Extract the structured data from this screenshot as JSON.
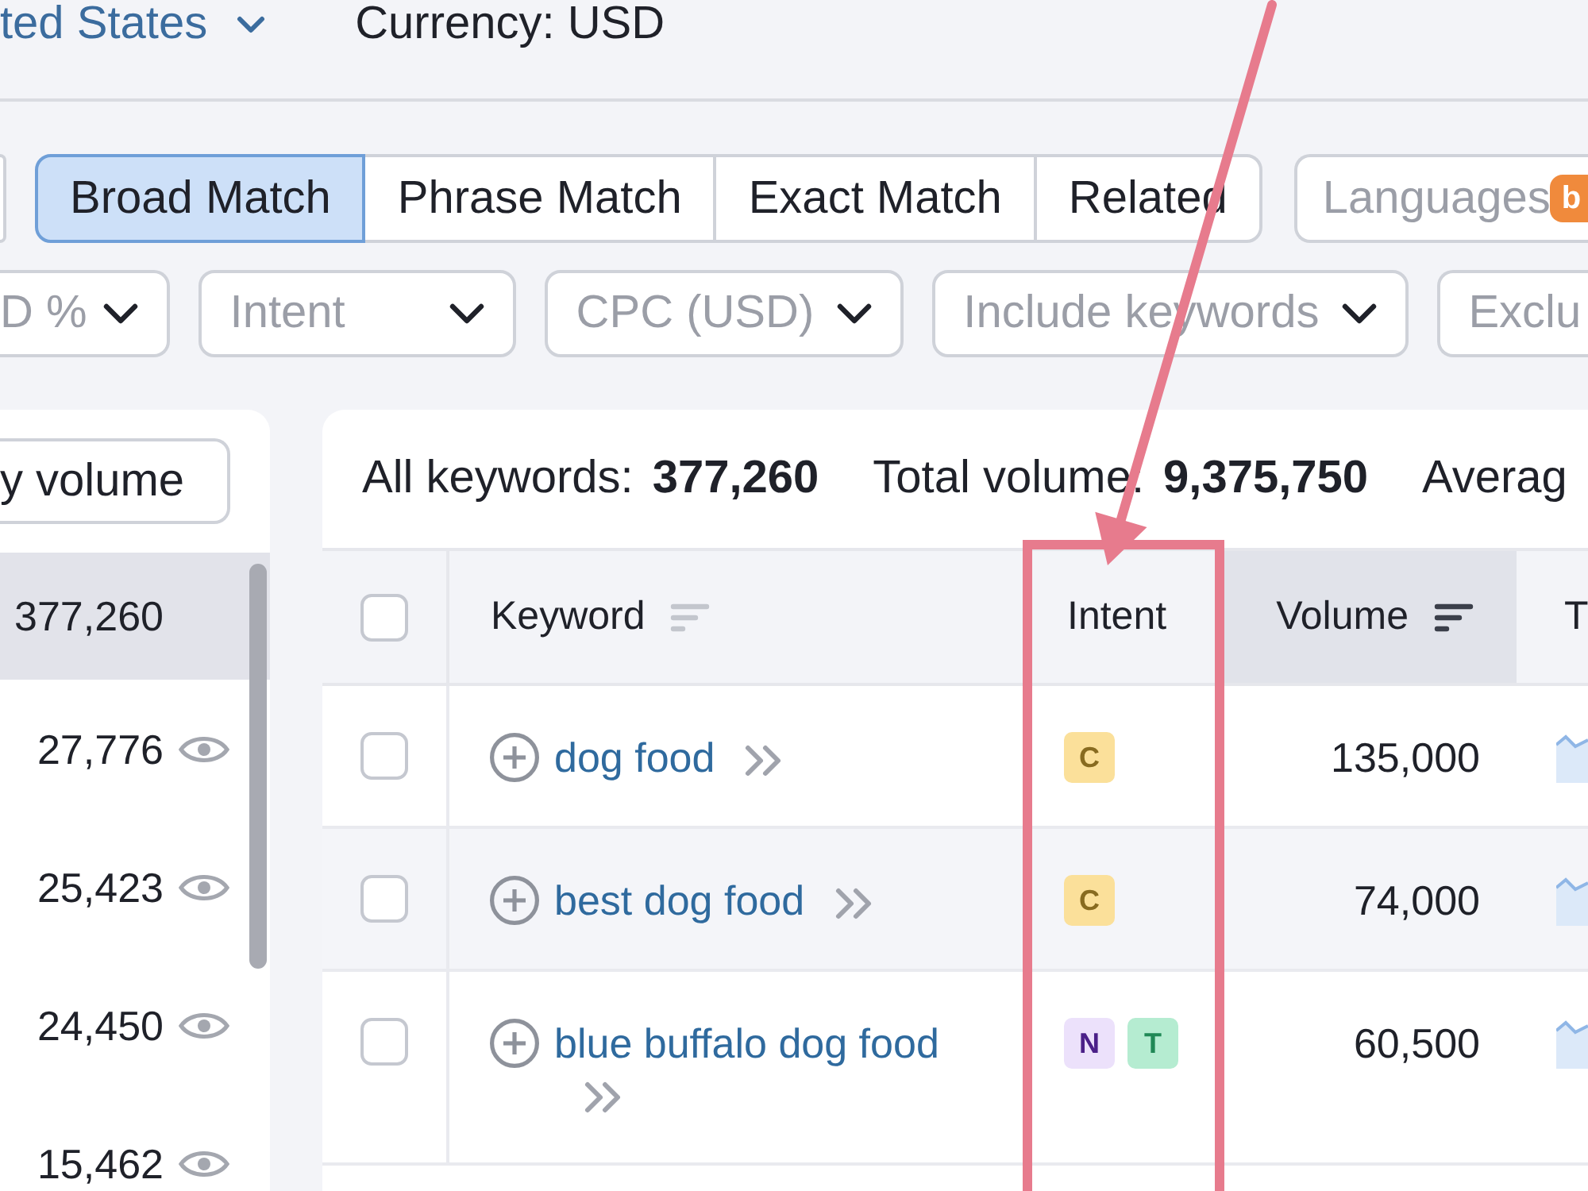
{
  "location_bar": {
    "database": "ted States",
    "currency": "Currency: USD"
  },
  "match_tabs": [
    {
      "label": "Broad Match",
      "selected": true
    },
    {
      "label": "Phrase Match",
      "selected": false
    },
    {
      "label": "Exact Match",
      "selected": false
    },
    {
      "label": "Related",
      "selected": false
    }
  ],
  "languages": {
    "label": "Languages",
    "badge": "b"
  },
  "filters": [
    {
      "label": "D %",
      "caret": true
    },
    {
      "label": "Intent",
      "caret": true
    },
    {
      "label": "CPC (USD)",
      "caret": true
    },
    {
      "label": "Include keywords",
      "caret": true
    },
    {
      "label": "Exclu",
      "caret": false
    }
  ],
  "groups_panel": {
    "sort_button": "y volume",
    "rows": [
      {
        "count": "377,260",
        "selected": true
      },
      {
        "count": "27,776",
        "selected": false
      },
      {
        "count": "25,423",
        "selected": false
      },
      {
        "count": "24,450",
        "selected": false
      },
      {
        "count": "15,462",
        "selected": false
      }
    ]
  },
  "summary": [
    {
      "label": "All keywords:",
      "value": "377,260"
    },
    {
      "label": "Total volume:",
      "value": "9,375,750"
    },
    {
      "label": "Averag"
    }
  ],
  "table": {
    "columns": [
      {
        "kind": "checkbox",
        "checked": false,
        "highlighted": false
      },
      {
        "kind": "text",
        "label": "Keyword",
        "sortable": true,
        "sorted": false,
        "highlighted": false
      },
      {
        "kind": "text",
        "label": "Intent",
        "sortable": false,
        "sorted": false,
        "highlighted": true
      },
      {
        "kind": "text",
        "label": "Volume",
        "sortable": true,
        "sorted": true,
        "highlighted": false
      },
      {
        "kind": "text",
        "label": "T",
        "sortable": false,
        "sorted": false,
        "highlighted": false
      }
    ],
    "rows": [
      {
        "checked": false,
        "hovered": false,
        "keyword": "dog food",
        "intents": [
          {
            "letter": "C",
            "color": "#fbe09a"
          }
        ],
        "volume": "135,000"
      },
      {
        "checked": false,
        "hovered": true,
        "keyword": "best dog food",
        "intents": [
          {
            "letter": "C",
            "color": "#fbe09a"
          }
        ],
        "volume": "74,000"
      },
      {
        "checked": false,
        "hovered": false,
        "keyword": "blue buffalo dog food",
        "intents": [
          {
            "letter": "N",
            "color": "#ece1fb"
          },
          {
            "letter": "T",
            "color": "#b5ecd1"
          }
        ],
        "volume": "60,500"
      }
    ]
  }
}
